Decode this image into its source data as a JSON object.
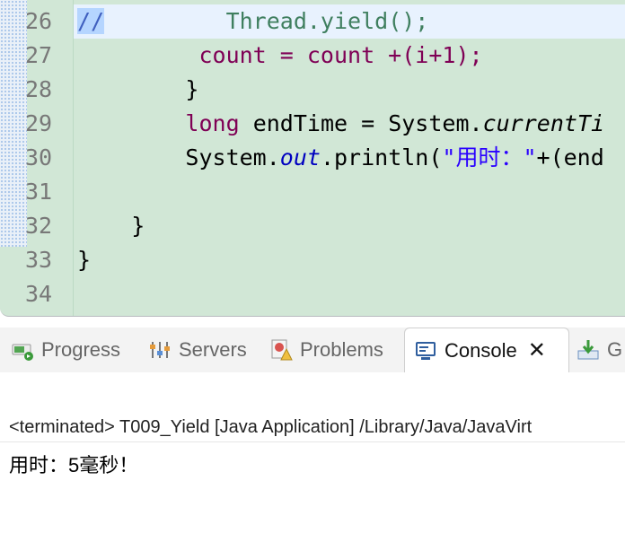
{
  "editor": {
    "line_numbers": [
      "26",
      "27",
      "28",
      "29",
      "30",
      "31",
      "32",
      "33",
      "34"
    ],
    "lines": {
      "l26": {
        "comment": "//",
        "indent": "         ",
        "code": "Thread.yield();"
      },
      "l27": {
        "indent": "         ",
        "code": "count = count +(i+1);"
      },
      "l28": {
        "indent": "        ",
        "code": "}"
      },
      "l29": {
        "indent": "        ",
        "kw": "long",
        "mid": " endTime = System.",
        "method": "currentTi"
      },
      "l30": {
        "indent": "        ",
        "pre": "System.",
        "field": "out",
        "mid": ".println(",
        "str": "\"用时：\"",
        "post": "+(end"
      },
      "l32": {
        "indent": "    ",
        "code": "}"
      },
      "l33": {
        "code": "}"
      }
    }
  },
  "tabs": [
    {
      "label": "Progress",
      "icon": "progress-icon"
    },
    {
      "label": "Servers",
      "icon": "servers-icon"
    },
    {
      "label": "Problems",
      "icon": "problems-icon"
    },
    {
      "label": "Console",
      "icon": "console-icon",
      "active": true
    },
    {
      "label": "G",
      "icon": "git-staging-icon"
    }
  ],
  "console": {
    "terminated_line": "<terminated> T009_Yield [Java Application] /Library/Java/JavaVirt",
    "output": "用时：5毫秒！"
  },
  "colors": {
    "editor_bg": "#d1e7d6",
    "keyword": "#7f0055",
    "string": "#2a00ff",
    "comment": "#3f7f5f",
    "field": "#0000c0"
  }
}
